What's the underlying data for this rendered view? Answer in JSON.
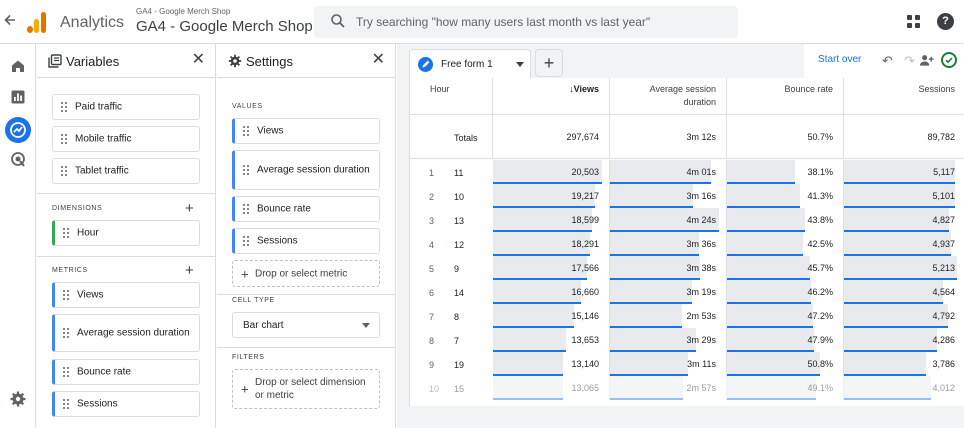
{
  "topbar": {
    "back_icon": "arrow-back-icon",
    "app_name": "Analytics",
    "account_small": "GA4 - Google Merch Shop",
    "account_big": "GA4 - Google Merch Shop",
    "search_placeholder": "Try searching \"how many users last month vs last year\""
  },
  "variables_panel": {
    "title": "Variables",
    "segments": [
      "Paid traffic",
      "Mobile traffic",
      "Tablet traffic"
    ],
    "dimensions_label": "DIMENSIONS",
    "dimensions": [
      "Hour"
    ],
    "metrics_label": "METRICS",
    "metrics": [
      "Views",
      "Average session duration",
      "Bounce rate",
      "Sessions"
    ]
  },
  "settings_panel": {
    "title": "Settings",
    "values_label": "VALUES",
    "values": [
      "Views",
      "Average session duration",
      "Bounce rate",
      "Sessions"
    ],
    "drop_metric": "Drop or select metric",
    "cell_type_label": "CELL TYPE",
    "cell_type": "Bar chart",
    "filters_label": "FILTERS",
    "drop_filter": "Drop or select dimension or metric"
  },
  "canvas": {
    "tab_label": "Free form 1",
    "start_over": "Start over",
    "colors": {
      "bar_bg": "#e8eaed",
      "bar_line": "#1a73e8",
      "accent": "#1a73e8"
    }
  },
  "table": {
    "columns": [
      "Hour",
      "Views",
      "Average session duration",
      "Bounce rate",
      "Sessions"
    ],
    "sorted_column": "Views",
    "sort_arrow": "↓",
    "totals_label": "Totals",
    "totals": [
      "297,674",
      "3m 12s",
      "50.7%",
      "89,782"
    ],
    "rows": [
      {
        "idx": "1",
        "hour": "11",
        "views": "20,503",
        "duration": "4m 01s",
        "bounce": "38.1%",
        "sessions": "5,117",
        "f": [
          1.0,
          0.93,
          0.62,
          0.98
        ]
      },
      {
        "idx": "2",
        "hour": "10",
        "views": "19,217",
        "duration": "3m 16s",
        "bounce": "41.3%",
        "sessions": "5,101",
        "f": [
          0.94,
          0.76,
          0.67,
          0.98
        ]
      },
      {
        "idx": "3",
        "hour": "13",
        "views": "18,599",
        "duration": "4m 24s",
        "bounce": "43.8%",
        "sessions": "4,827",
        "f": [
          0.91,
          1.0,
          0.72,
          0.93
        ]
      },
      {
        "idx": "4",
        "hour": "12",
        "views": "18,291",
        "duration": "3m 36s",
        "bounce": "42.5%",
        "sessions": "4,937",
        "f": [
          0.89,
          0.82,
          0.7,
          0.95
        ]
      },
      {
        "idx": "5",
        "hour": "9",
        "views": "17,566",
        "duration": "3m 38s",
        "bounce": "45.7%",
        "sessions": "5,213",
        "f": [
          0.86,
          0.83,
          0.76,
          1.0
        ]
      },
      {
        "idx": "6",
        "hour": "14",
        "views": "16,660",
        "duration": "3m 19s",
        "bounce": "46.2%",
        "sessions": "4,564",
        "f": [
          0.81,
          0.75,
          0.77,
          0.88
        ]
      },
      {
        "idx": "7",
        "hour": "8",
        "views": "15,146",
        "duration": "2m 53s",
        "bounce": "47.2%",
        "sessions": "4,792",
        "f": [
          0.74,
          0.66,
          0.79,
          0.92
        ]
      },
      {
        "idx": "8",
        "hour": "7",
        "views": "13,653",
        "duration": "3m 29s",
        "bounce": "47.9%",
        "sessions": "4,286",
        "f": [
          0.67,
          0.79,
          0.8,
          0.82
        ]
      },
      {
        "idx": "9",
        "hour": "19",
        "views": "13,140",
        "duration": "3m 11s",
        "bounce": "50.8%",
        "sessions": "3,786",
        "f": [
          0.64,
          0.72,
          0.85,
          0.73
        ]
      },
      {
        "idx": "10",
        "hour": "15",
        "views": "13,065",
        "duration": "2m 57s",
        "bounce": "49.1%",
        "sessions": "4,012",
        "f": [
          0.64,
          0.67,
          0.82,
          0.77
        ]
      }
    ]
  }
}
